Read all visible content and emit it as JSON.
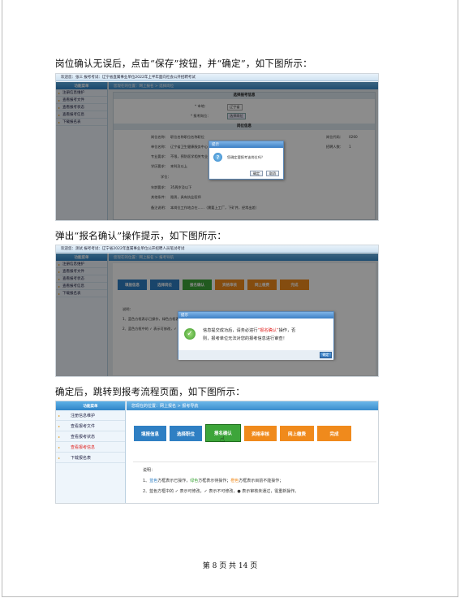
{
  "paragraphs": {
    "p1": "岗位确认无误后，点击“保存”按钮，并“确定”，如下图所示：",
    "p2": "弹出“报名确认”操作提示，如下图所示：",
    "p3": "确定后，跳转到报考流程页面，如下图所示："
  },
  "shot1": {
    "topbar": "欢迎您：张三    报考考试：辽宁省直属事业单位2022年上半年面向社会公开招聘考试",
    "side_head": "功能菜单",
    "side_items": [
      "注册信息维护",
      "查看报考文件",
      "查看报考状态",
      "查看报考信息",
      "下载报名表"
    ],
    "crumb": "您现在的位置：网上报名 > 选择岗位",
    "section1": "选择报考信息",
    "field_unit_label": "* 市地：",
    "field_unit_value": "辽宁省",
    "field_post_label": "* 报考岗位：",
    "field_post_button": "选择岗位",
    "section2": "岗位信息",
    "info_labels": [
      "岗位名称：",
      "单位名称：",
      "专业要求：",
      "学历要求：",
      "学位：",
      "年龄要求：",
      "其他条件：",
      "备注说明："
    ],
    "info_values": [
      "职位名称职位名称职位",
      "辽宁省卫生健康服务中心",
      "不限，预防医学相关专业",
      "本科及以上",
      "",
      "35周岁及以下",
      "限男，具有执业医师",
      "本岗位工作地点在……（需要上工厂，下矿井，经常出差）"
    ],
    "right_labels": [
      "岗位代码：",
      "招聘人数："
    ],
    "right_values": [
      "0260",
      "1"
    ],
    "dialog_title": "提示",
    "dialog_text": "您确定要报考该岗位吗？",
    "dialog_ok": "确定",
    "dialog_cancel": "取消"
  },
  "shot2": {
    "topbar": "欢迎您：测试    报考考试：辽宁省2022年直属事业单位公开招聘人员笔试考试",
    "side_head": "功能菜单",
    "side_items": [
      "注册信息维护",
      "查看报考文件",
      "查看报考状态",
      "查看报考信息",
      "下载报名表"
    ],
    "crumb": "您现在的位置：网上报名 > 报考导航",
    "steps": [
      "填报信息",
      "选择岗位",
      "报名确认",
      "资格审核",
      "网上缴费",
      "完成"
    ],
    "notes": [
      "说明：",
      "1、蓝色方框表示已操作，绿色方框表示待操作；",
      "2、蓝色方框中的 ✓ 表示可修改，✓ 表示不可修改"
    ],
    "dialog_title": "提示",
    "dialog_text_a": "信息提交成功后，请务必进行",
    "dialog_text_highlight": "“报名确认”",
    "dialog_text_b": "操作，否",
    "dialog_text_c": "则，报考单位无法对您的报考信息进行审查！",
    "dialog_ok": "确定"
  },
  "shot3": {
    "side_head": "功能菜单",
    "side_items": [
      "注册信息维护",
      "查看报考文件",
      "查看报考状态",
      "查看报考信息",
      "下载报名表"
    ],
    "crumb": "您现在的位置：网上报名 > 报考导航",
    "steps": [
      "填报信息",
      "选择职位",
      "报名确认",
      "资格审核",
      "网上缴费",
      "完成"
    ],
    "notes_title": "说明：",
    "note1_a": "1、",
    "note1_blue": "蓝色",
    "note1_b": "方框表示已操作，",
    "note1_green": "绿色",
    "note1_c": "方框表示待操作；",
    "note1_orange": "橙色",
    "note1_d": "方框表示目前不能操作；",
    "note2": "2、蓝色方框中的 ✓ 表示可修改，✓ 表示不可修改，● 表示审核未通过，需重新操作。"
  },
  "footer": "第 8 页 共 14 页",
  "colors": {
    "step_blue": "#2f7fc3",
    "step_green": "#3da53a",
    "step_orange": "#f08a1c",
    "highlight_red": "#e0201e"
  }
}
